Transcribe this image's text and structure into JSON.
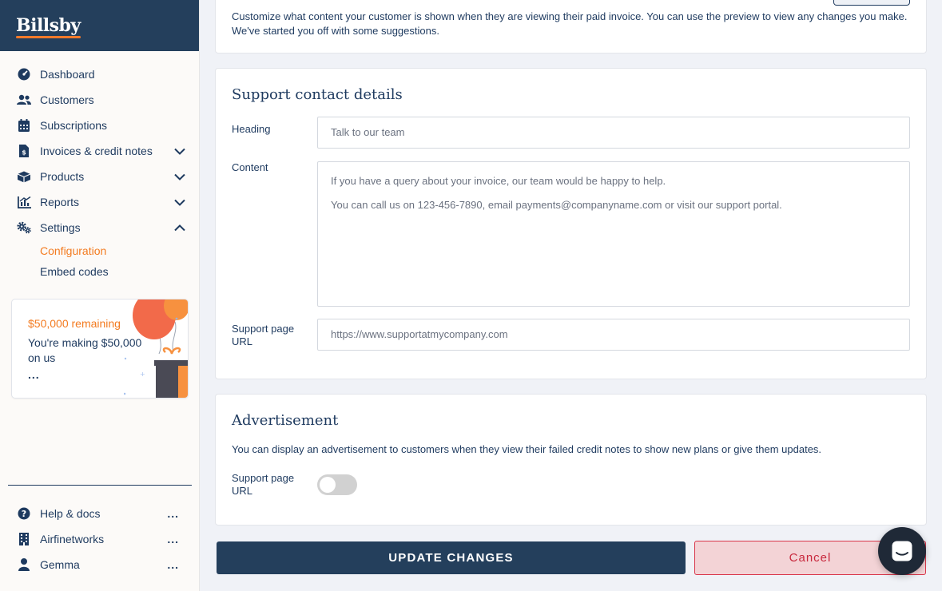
{
  "brand": {
    "name": "Billsby"
  },
  "nav": {
    "items": [
      {
        "label": "Dashboard",
        "icon": "dashboard-icon"
      },
      {
        "label": "Customers",
        "icon": "users-icon"
      },
      {
        "label": "Subscriptions",
        "icon": "calendar-icon"
      },
      {
        "label": "Invoices & credit notes",
        "icon": "invoice-icon",
        "chevron": "down"
      },
      {
        "label": "Products",
        "icon": "products-icon",
        "chevron": "down"
      },
      {
        "label": "Reports",
        "icon": "reports-icon",
        "chevron": "down"
      },
      {
        "label": "Settings",
        "icon": "gears-icon",
        "chevron": "up"
      }
    ],
    "sub_items": [
      {
        "label": "Configuration",
        "active": true
      },
      {
        "label": "Embed codes",
        "active": false
      }
    ]
  },
  "promo": {
    "amount": "$50,000 remaining",
    "text": "You're making $50,000 on us",
    "more": "..."
  },
  "bottom_nav": {
    "items": [
      {
        "label": "Help & docs",
        "icon": "help-icon",
        "more": "..."
      },
      {
        "label": "Airfinetworks",
        "icon": "building-icon",
        "more": "..."
      },
      {
        "label": "Gemma",
        "icon": "user-icon",
        "more": "..."
      }
    ]
  },
  "invoice_section": {
    "description_line1": "Customize what content your customer is shown when they are viewing their paid invoice. You can use the preview to view any changes you make.",
    "description_line2": "We've started you off with some suggestions."
  },
  "support": {
    "title": "Support contact details",
    "heading_label": "Heading",
    "heading_value": "Talk to our team",
    "content_label": "Content",
    "content_line1": "If you have a query about your invoice, our team would be happy to help.",
    "content_line2": "You can call us on 123-456-7890, email payments@companyname.com or visit our support portal.",
    "url_label": "Support page URL",
    "url_value": "https://www.supportatmycompany.com"
  },
  "advertisement": {
    "title": "Advertisement",
    "description": "You can display an advertisement to customers when they view their failed credit notes to show new plans or give them updates.",
    "toggle_label": "Support page URL",
    "toggle_on": false
  },
  "actions": {
    "update_label": "UPDATE CHANGES",
    "cancel_label": "Cancel"
  },
  "colors": {
    "navy": "#243f5c",
    "accent_orange": "#f37b20",
    "cancel_red": "#c8283d"
  }
}
